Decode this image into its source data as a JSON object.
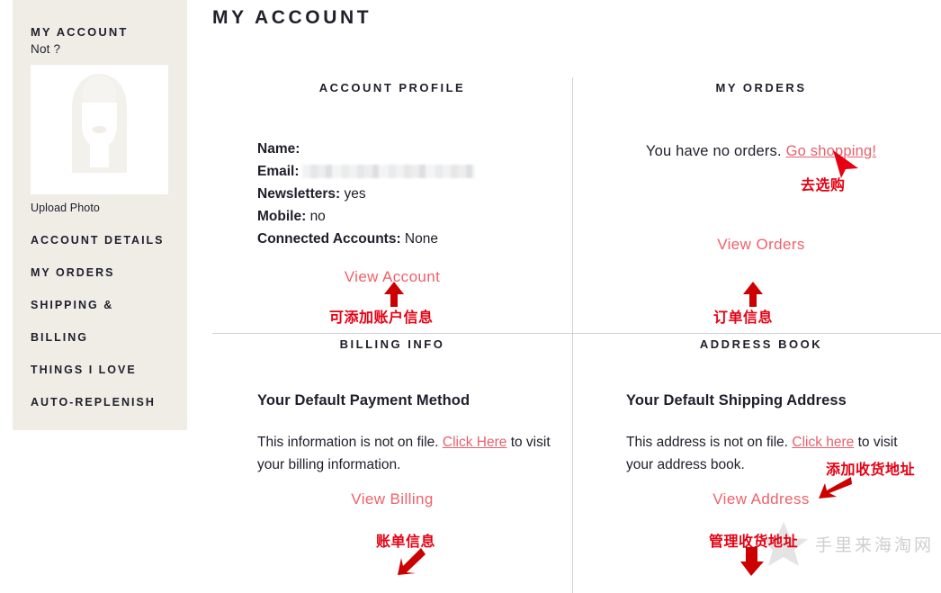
{
  "sidebar": {
    "title": "MY ACCOUNT",
    "greeting": "Not ?",
    "upload_photo_label": "Upload Photo",
    "avatar_icon": "female-silhouette-avatar-icon",
    "nav_items": [
      {
        "label": "ACCOUNT DETAILS"
      },
      {
        "label": "MY ORDERS"
      },
      {
        "label": "SHIPPING &"
      },
      {
        "label": "BILLING"
      },
      {
        "label": "THINGS I LOVE"
      },
      {
        "label": "AUTO-REPLENISH"
      }
    ]
  },
  "page": {
    "title": "MY ACCOUNT"
  },
  "profile": {
    "heading": "ACCOUNT PROFILE",
    "fields": [
      {
        "label": "Name:",
        "value": ""
      },
      {
        "label": "Email:",
        "value": ""
      },
      {
        "label": "Newsletters:",
        "value": "yes"
      },
      {
        "label": "Mobile:",
        "value": "no"
      },
      {
        "label": "Connected Accounts:",
        "value": "None"
      }
    ],
    "view_link": "View Account"
  },
  "orders": {
    "heading": "MY ORDERS",
    "empty_text": "You have no orders.",
    "shop_link": "Go shopping!",
    "view_link": "View Orders"
  },
  "billing": {
    "heading": "BILLING INFO",
    "sub_heading": "Your Default Payment Method",
    "text_before": "This information is not on file.",
    "link_text": "Click Here",
    "text_after": "to visit your billing information.",
    "view_link": "View Billing"
  },
  "address": {
    "heading": "ADDRESS BOOK",
    "sub_heading": "Your Default Shipping Address",
    "text_before": "This address is not on file.",
    "link_text": "Click here",
    "text_after": "to visit your address book.",
    "view_link": "View Address"
  },
  "annotations": {
    "accent_color": "#e60012",
    "notes": [
      {
        "id": "go-shopping",
        "text": "去选购"
      },
      {
        "id": "view-account",
        "text": "可添加账户信息"
      },
      {
        "id": "view-orders",
        "text": "订单信息"
      },
      {
        "id": "billing-click",
        "text": "账单信息"
      },
      {
        "id": "address-click",
        "text": "添加收货地址"
      },
      {
        "id": "address-manage",
        "text": "管理收货地址"
      }
    ]
  },
  "watermark": {
    "text": "手里来海淘网",
    "icon": "star-icon"
  },
  "colors": {
    "sidebar_bg": "#f0ede7",
    "link_red": "#f0616a",
    "annotation_red": "#e60012",
    "divider": "#d2d2d2",
    "text": "#20202c"
  }
}
